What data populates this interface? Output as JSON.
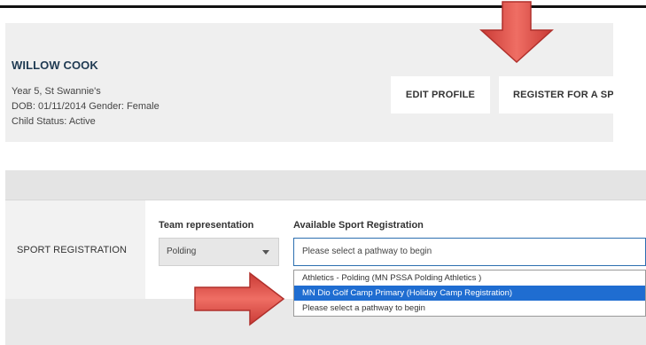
{
  "child": {
    "name": "WILLOW COOK",
    "year_school": "Year 5, St Swannie's",
    "dob_gender": "DOB: 01/11/2014 Gender: Female",
    "status": "Child Status: Active"
  },
  "actions": {
    "edit_profile": "EDIT PROFILE",
    "register_sport": "REGISTER FOR A SPOR"
  },
  "registration": {
    "section_label": "SPORT REGISTRATION",
    "team_label": "Team representation",
    "team_value": "Polding",
    "available_label": "Available Sport Registration",
    "available_placeholder": "Please select a pathway to begin",
    "options": [
      "Athletics - Polding (MN PSSA Polding Athletics )",
      "MN Dio Golf Camp Primary (Holiday Camp Registration)",
      "Please select a pathway to begin"
    ],
    "selected_option_index": 1
  },
  "colors": {
    "accent_blue": "#1f6dd1",
    "arrow_red": "#e0504a",
    "name_navy": "#1f3a52"
  },
  "icons": {
    "down_arrow": "red-down-arrow-icon",
    "right_arrow": "red-right-arrow-icon",
    "caret": "chevron-down-icon"
  }
}
